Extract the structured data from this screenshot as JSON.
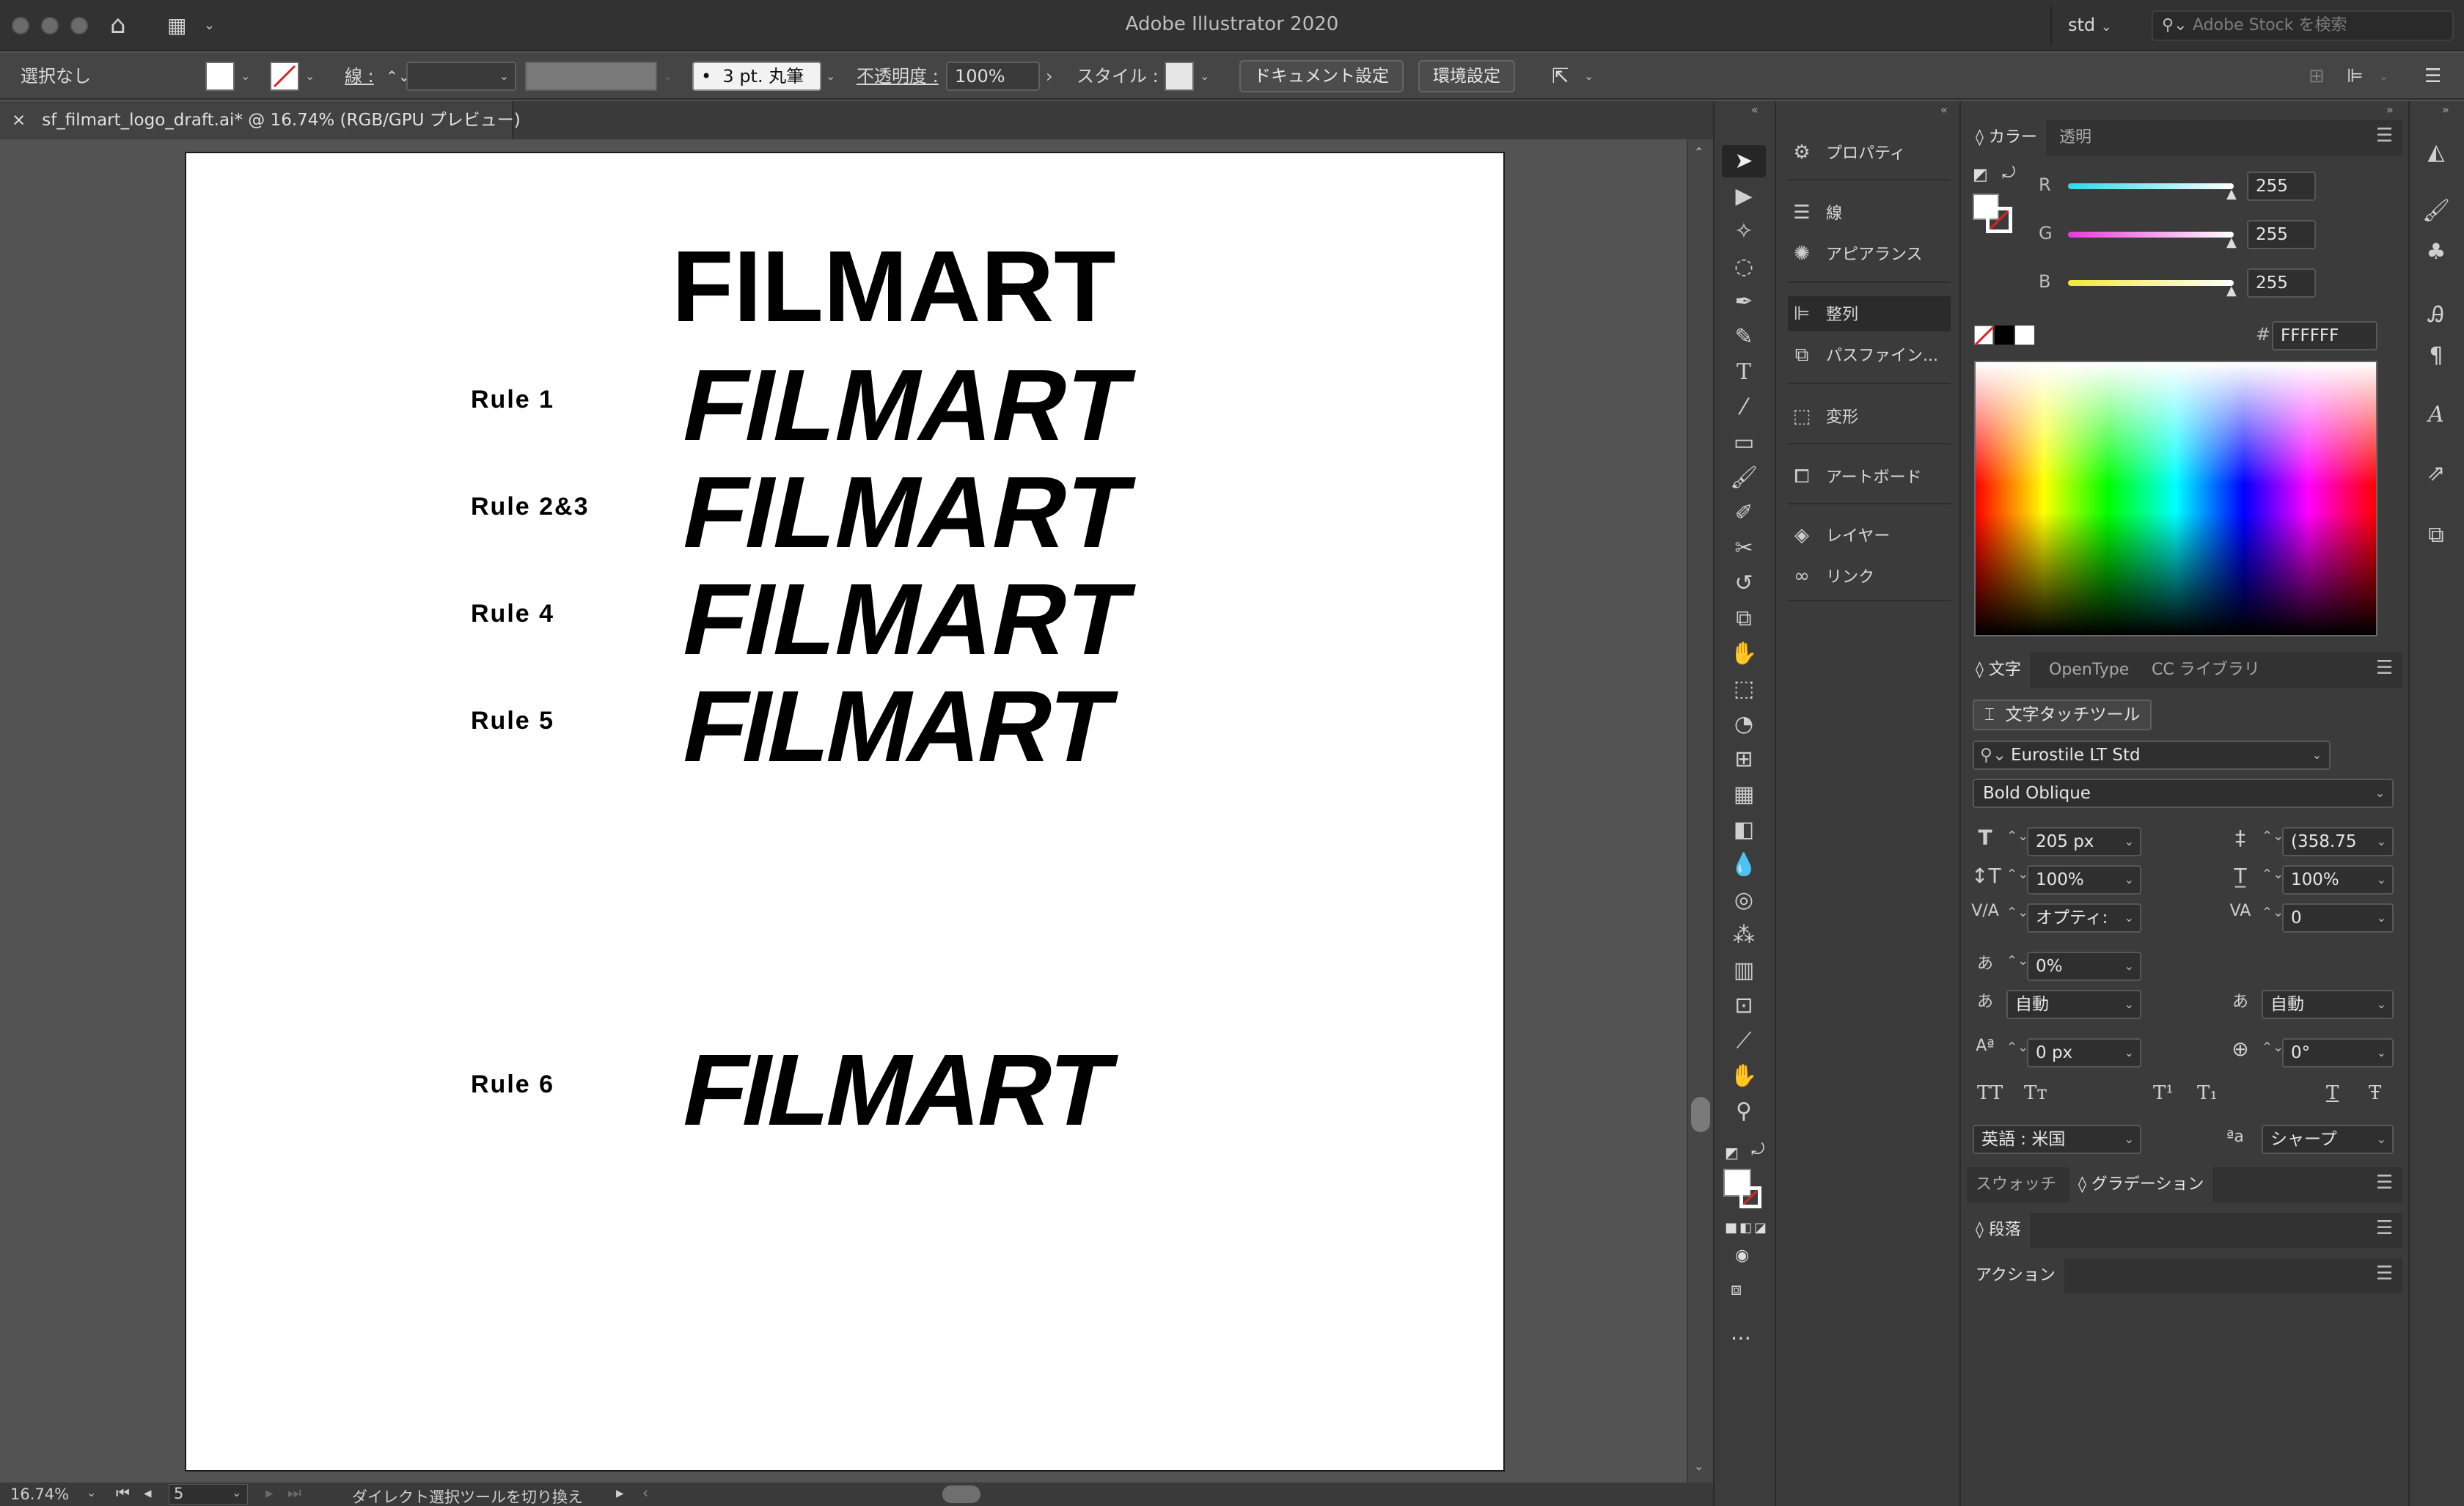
{
  "app": {
    "title": "Adobe Illustrator 2020",
    "workspace": "std",
    "stock_search_placeholder": "Adobe Stock を検索"
  },
  "control": {
    "selection": "選択なし",
    "stroke_label": "線 :",
    "brush": "3 pt. 丸筆",
    "opacity_label": "不透明度 :",
    "opacity_value": "100%",
    "style_label": "スタイル :",
    "doc_settings": "ドキュメント設定",
    "prefs": "環境設定"
  },
  "document": {
    "tab_title": "sf_filmart_logo_draft.ai* @ 16.74% (RGB/GPU プレビュー)",
    "close": "×"
  },
  "artboard": {
    "logos": [
      {
        "label": "",
        "text": "FILMART"
      },
      {
        "label": "Rule  1",
        "text": "FILMART"
      },
      {
        "label": "Rule  2&3",
        "text": "FILMART"
      },
      {
        "label": "Rule  4",
        "text": "FILMART"
      },
      {
        "label": "Rule  5",
        "text": "FILMART"
      },
      {
        "label": "Rule  6",
        "text": "FILMART"
      }
    ]
  },
  "status": {
    "zoom": "16.74%",
    "artboard_num": "5",
    "message": "ダイレクト選択ツールを切り換え"
  },
  "dock": {
    "items": [
      {
        "label": "プロパティ",
        "icon": "properties-icon"
      },
      {
        "label": "線",
        "icon": "stroke-icon"
      },
      {
        "label": "アピアランス",
        "icon": "appearance-icon"
      },
      {
        "label": "整列",
        "icon": "align-icon"
      },
      {
        "label": "パスファイン...",
        "icon": "pathfinder-icon"
      },
      {
        "label": "変形",
        "icon": "transform-icon"
      },
      {
        "label": "アートボード",
        "icon": "artboards-icon"
      },
      {
        "label": "レイヤー",
        "icon": "layers-icon"
      },
      {
        "label": "リンク",
        "icon": "links-icon"
      }
    ]
  },
  "color_panel": {
    "tabs": [
      "カラー",
      "透明"
    ],
    "r_label": "R",
    "r_value": "255",
    "g_label": "G",
    "g_value": "255",
    "b_label": "B",
    "b_value": "255",
    "hex_label": "#",
    "hex": "FFFFFF"
  },
  "char_panel": {
    "tabs": [
      "文字",
      "OpenType",
      "CC ライブラリ"
    ],
    "touch_tool": "文字タッチツール",
    "font_family": "Eurostile LT Std",
    "font_style": "Bold Oblique",
    "size": "205 px",
    "leading": "(358.75",
    "vscale": "100%",
    "hscale": "100%",
    "kerning": "オプティ:",
    "tracking": "0",
    "tsume": "0%",
    "aki_left": "自動",
    "aki_right": "自動",
    "baseline": "0 px",
    "rotation": "0°",
    "caps_all": "TT",
    "caps_small": "Tт",
    "superscript": "T¹",
    "subscript": "T₁",
    "underline": "T",
    "strike": "Ŧ",
    "language": "英語 : 米国",
    "antialias_label": "ªa",
    "antialias": "シャープ"
  },
  "lower_panels": {
    "swatch_tab": "スウォッチ",
    "gradient_tab": "グラデーション",
    "paragraph": "段落",
    "actions": "アクション"
  },
  "colors": {
    "accent_cyan": "#2fd9e8",
    "accent_magenta": "#e83ad9",
    "accent_yellow": "#f1e938"
  }
}
